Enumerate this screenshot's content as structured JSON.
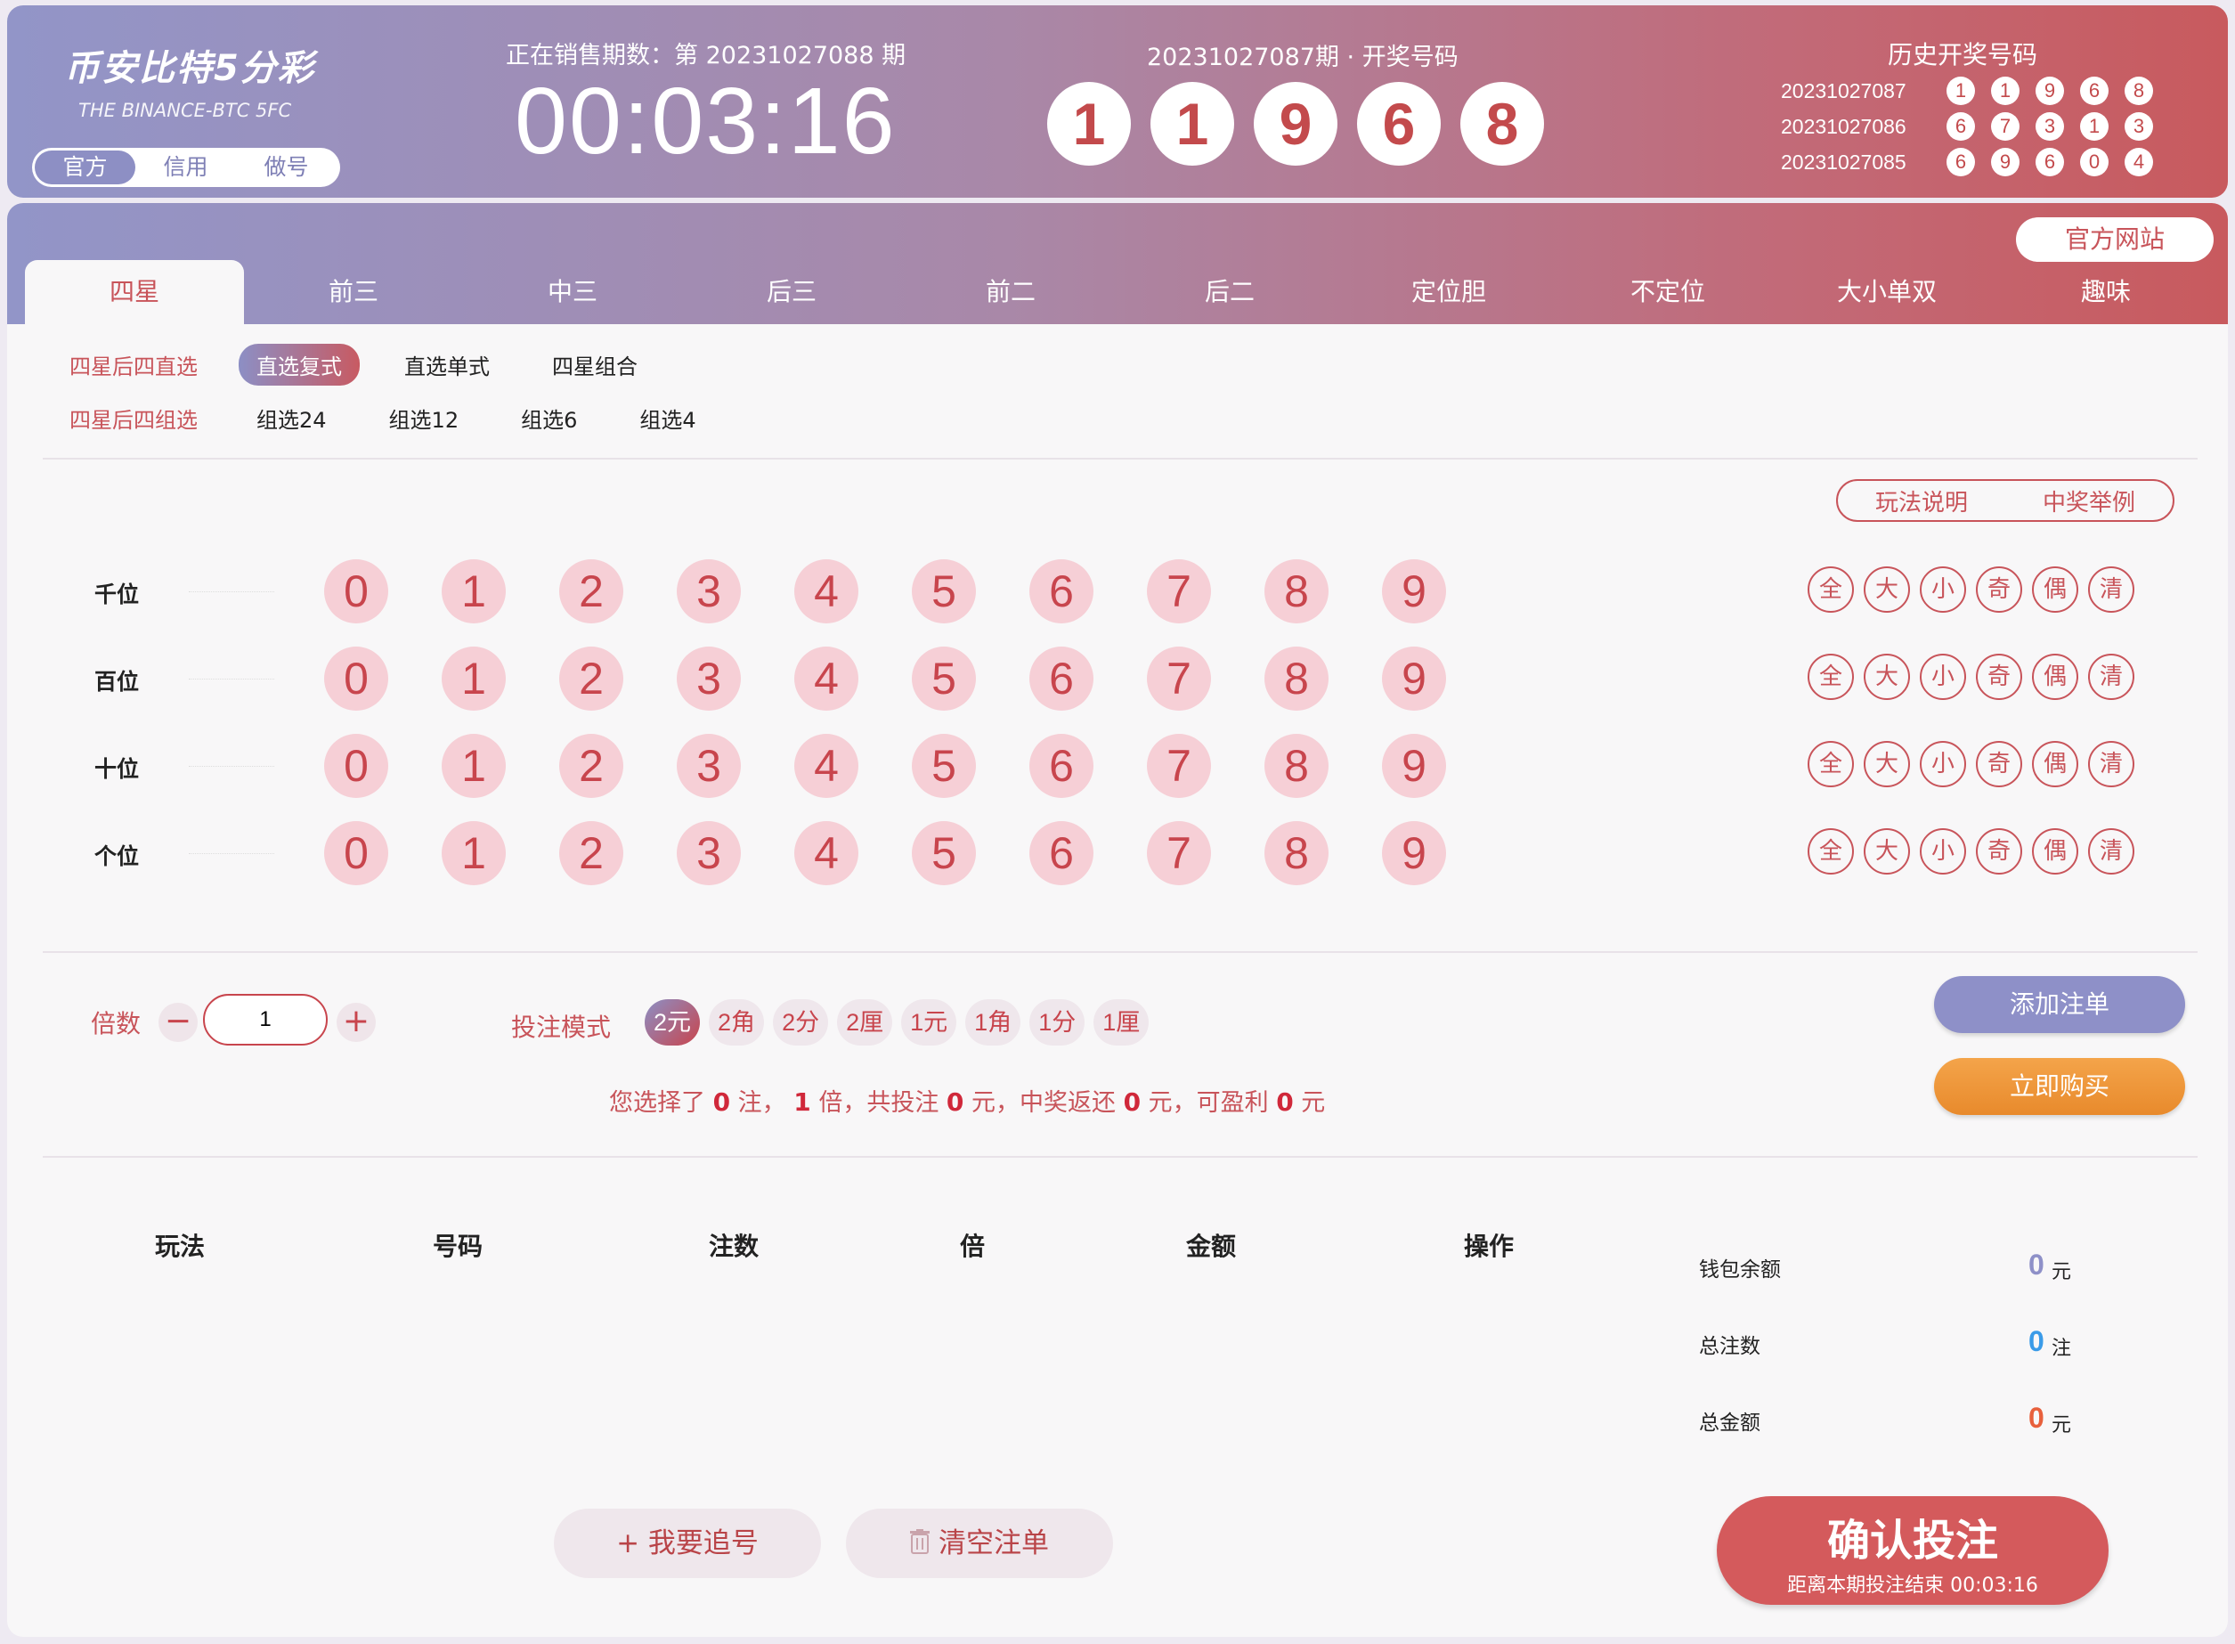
{
  "header": {
    "logo_title": "币安比特5分彩",
    "logo_subtitle": "THE BINANCE-BTC 5FC",
    "modes": [
      "官方",
      "信用",
      "做号"
    ],
    "active_mode": 0,
    "sale_label": "正在销售期数：第 20231027088 期",
    "countdown": "00:03:16",
    "draw_label": "20231027087期 · 开奖号码",
    "draw_numbers": [
      "1",
      "1",
      "9",
      "6",
      "8"
    ],
    "history_title": "历史开奖号码",
    "history": [
      {
        "issue": "20231027087",
        "numbers": [
          "1",
          "1",
          "9",
          "6",
          "8"
        ]
      },
      {
        "issue": "20231027086",
        "numbers": [
          "6",
          "7",
          "3",
          "1",
          "3"
        ]
      },
      {
        "issue": "20231027085",
        "numbers": [
          "6",
          "9",
          "6",
          "0",
          "4"
        ]
      }
    ]
  },
  "nav": {
    "official_site": "官方网站",
    "tabs": [
      "四星",
      "前三",
      "中三",
      "后三",
      "前二",
      "后二",
      "定位胆",
      "不定位",
      "大小单双",
      "趣味"
    ],
    "active_tab": 0
  },
  "subplays": [
    {
      "title": "四星后四直选",
      "items": [
        "直选复式",
        "直选单式",
        "四星组合"
      ],
      "active": 0
    },
    {
      "title": "四星后四组选",
      "items": [
        "组选24",
        "组选12",
        "组选6",
        "组选4"
      ],
      "active": -1
    }
  ],
  "help": {
    "rules": "玩法说明",
    "example": "中奖举例"
  },
  "picker": {
    "positions": [
      "千位",
      "百位",
      "十位",
      "个位"
    ],
    "digits": [
      "0",
      "1",
      "2",
      "3",
      "4",
      "5",
      "6",
      "7",
      "8",
      "9"
    ],
    "quick": [
      "全",
      "大",
      "小",
      "奇",
      "偶",
      "清"
    ]
  },
  "bet": {
    "multiplier_label": "倍数",
    "minus": "−",
    "plus": "+",
    "multiplier_value": "1",
    "mode_label": "投注模式",
    "units": [
      "2元",
      "2角",
      "2分",
      "2厘",
      "1元",
      "1角",
      "1分",
      "1厘"
    ],
    "active_unit": 0,
    "summary": {
      "p1": "您选择了 ",
      "count": "0",
      "p2": " 注， ",
      "times": "1",
      "p3": " 倍，共投注 ",
      "amount": "0",
      "p4": " 元，中奖返还 ",
      "returns": "0",
      "p5": " 元，可盈利 ",
      "profit": "0",
      "p6": " 元"
    },
    "add_label": "添加注单",
    "buy_label": "立即购买"
  },
  "cart": {
    "columns": [
      "玩法",
      "号码",
      "注数",
      "倍",
      "金额",
      "操作"
    ],
    "wallet_label": "钱包余额",
    "wallet_value": "0",
    "wallet_unit": "元",
    "count_label": "总注数",
    "count_value": "0",
    "count_unit": "注",
    "total_label": "总金额",
    "total_value": "0",
    "total_unit": "元",
    "chase_label": "+ 我要追号",
    "clear_label": "清空注单",
    "confirm_title": "确认投注",
    "confirm_sub": "距离本期投注结束 00:03:16"
  },
  "colors": {
    "accent": "#c8545a",
    "purple": "#8e90c8",
    "orange": "#ee9436",
    "ball_bg": "#f6cfd6",
    "wallet_value": "#8e90c8",
    "count_value": "#3a9be8",
    "total_value": "#e8603c"
  }
}
